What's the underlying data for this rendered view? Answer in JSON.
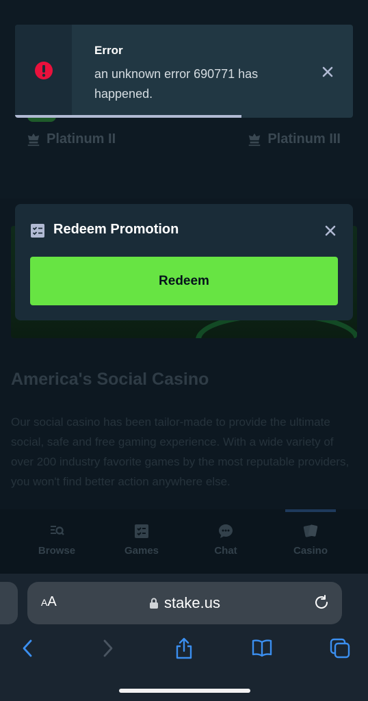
{
  "toast": {
    "title": "Error",
    "message": "an unknown error 690771 has happened.",
    "progress": 0.67
  },
  "background": {
    "tiers": [
      "Platinum II",
      "Platinum III"
    ],
    "section_title": "America's Social Casino",
    "section_body": "Our social casino has been tailor-made to provide the ultimate social, safe and free gaming experience. With a wide variety of over 200 industry favorite games by the most reputable providers, you won't find better action anywhere else."
  },
  "modal": {
    "title": "Redeem Promotion",
    "button_label": "Redeem"
  },
  "bottom_nav": {
    "items": [
      {
        "label": "Browse",
        "icon": "browse-icon"
      },
      {
        "label": "Games",
        "icon": "games-icon"
      },
      {
        "label": "Chat",
        "icon": "chat-icon"
      },
      {
        "label": "Casino",
        "icon": "casino-icon"
      }
    ],
    "active": "Casino"
  },
  "browser": {
    "text_size_label_small": "A",
    "text_size_label_large": "A",
    "url": "stake.us"
  },
  "colors": {
    "accent_green": "#67e443",
    "error_red": "#e9113c",
    "panel": "#213743"
  }
}
